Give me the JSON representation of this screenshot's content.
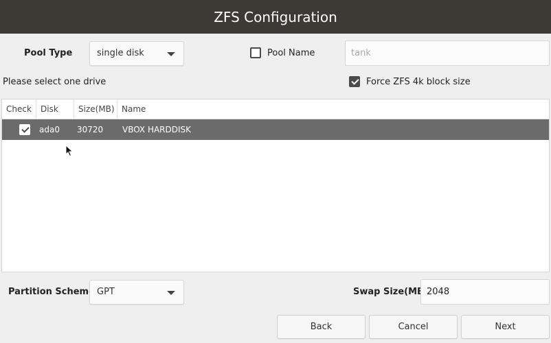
{
  "window": {
    "title": "ZFS Configuration"
  },
  "pool": {
    "type_label": "Pool Type",
    "type_value": "single disk",
    "name_label": "Pool Name",
    "name_checked": false,
    "name_placeholder": "tank"
  },
  "drive": {
    "instruction": "Please select one drive",
    "force4k_label": "Force ZFS 4k block size",
    "force4k_checked": true
  },
  "table": {
    "headers": [
      "Check",
      "Disk",
      "Size(MB)",
      "Name"
    ],
    "rows": [
      {
        "checked": true,
        "disk": "ada0",
        "size": "30720",
        "name": "VBOX HARDDISK",
        "selected": true
      }
    ]
  },
  "partition": {
    "label": "Partition Scheme",
    "value": "GPT"
  },
  "swap": {
    "label": "Swap Size(MB)",
    "value": "2048"
  },
  "buttons": {
    "back": "Back",
    "cancel": "Cancel",
    "next": "Next"
  },
  "icons": {
    "dropdown": "chevron-down-icon",
    "checkbox": "checkbox-icon",
    "cursor": "mouse-pointer-icon"
  }
}
